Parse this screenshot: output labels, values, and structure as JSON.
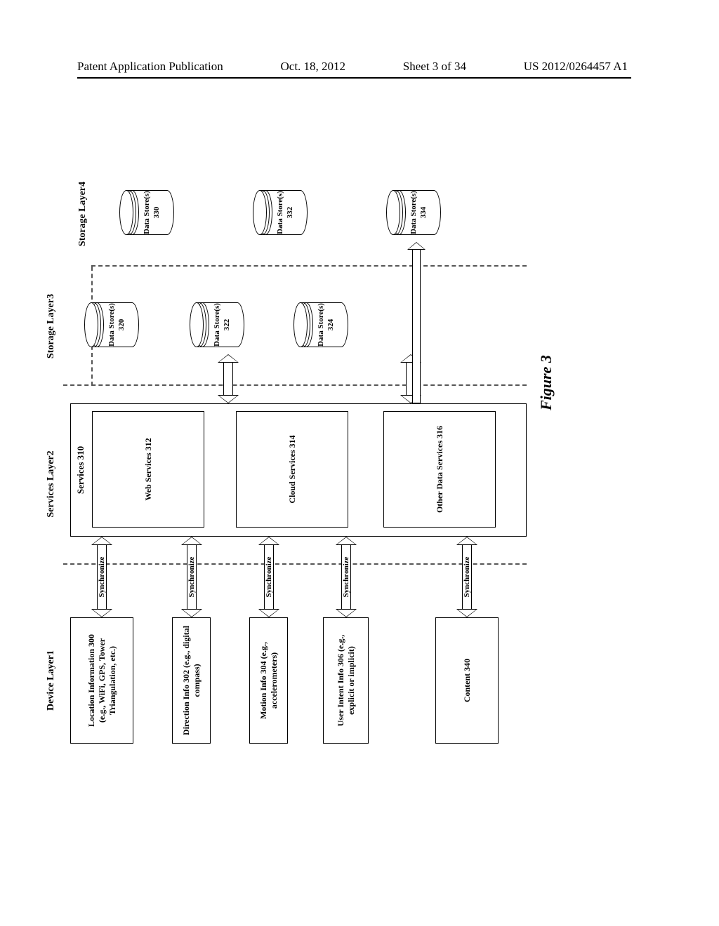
{
  "header": {
    "left": "Patent Application Publication",
    "date": "Oct. 18, 2012",
    "sheet": "Sheet 3 of 34",
    "pubno": "US 2012/0264457 A1"
  },
  "layers": {
    "device": "Device Layer1",
    "services": "Services Layer2",
    "storage3": "Storage Layer3",
    "storage4": "Storage Layer4"
  },
  "device_boxes": {
    "location": "Location Information 300\n(e.g., WiFi, GPS, Tower Triangulation, etc.)",
    "direction": "Direction Info 302 (e.g., digital compass)",
    "motion": "Motion Info 304 (e.g., accelerometers)",
    "intent": "User Intent Info 306 (e.g., explicit or implicit)",
    "content": "Content 340"
  },
  "sync": "Synchronize",
  "services_box": {
    "title": "Services 310",
    "web": "Web Services 312",
    "cloud": "Cloud Services 314",
    "other": "Other Data Services 316"
  },
  "stores": {
    "s320": "Data Store(s) 320",
    "s322": "Data Store(s) 322",
    "s324": "Data Store(s) 324",
    "s330": "Data Store(s) 330",
    "s332": "Data Store(s) 332",
    "s334": "Data Store(s) 334"
  },
  "figure": "Figure 3"
}
